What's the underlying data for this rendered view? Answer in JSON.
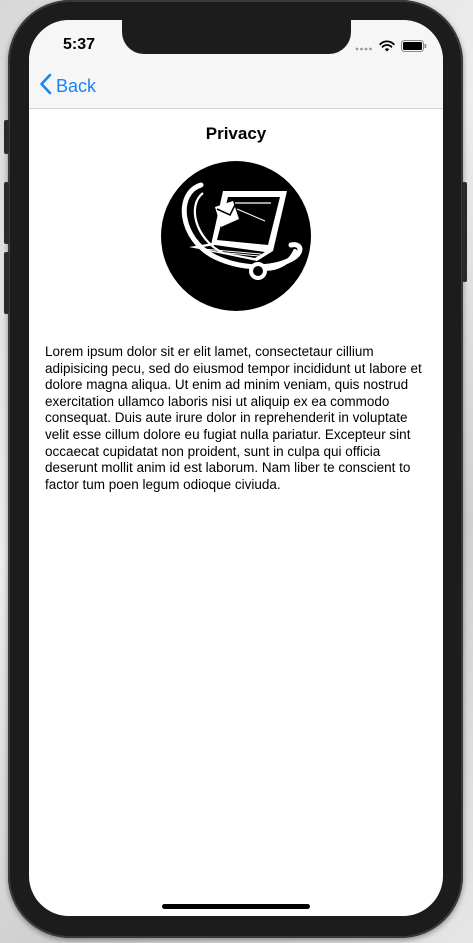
{
  "status_bar": {
    "time": "5:37",
    "icons": [
      "signal-icon",
      "wifi-icon",
      "battery-icon"
    ]
  },
  "navbar": {
    "back_label": "Back",
    "back_icon": "chevron-left-icon"
  },
  "page": {
    "title": "Privacy",
    "logo_icon": "laptop-privacy-icon",
    "body": "Lorem ipsum dolor sit er elit lamet, consectetaur cillium adipisicing pecu, sed do eiusmod tempor incididunt ut labore et dolore magna aliqua. Ut enim ad minim veniam, quis nostrud exercitation ullamco laboris nisi ut aliquip ex ea commodo consequat. Duis aute irure dolor in reprehenderit in voluptate velit esse cillum dolore eu fugiat nulla pariatur. Excepteur sint occaecat cupidatat non proident, sunt in culpa qui officia deserunt mollit anim id est laborum. Nam liber te conscient to factor tum poen legum odioque civiuda."
  },
  "colors": {
    "accent": "#1a82f7",
    "navbar_bg": "#f6f6f6",
    "device_frame": "#1c1c1c"
  }
}
